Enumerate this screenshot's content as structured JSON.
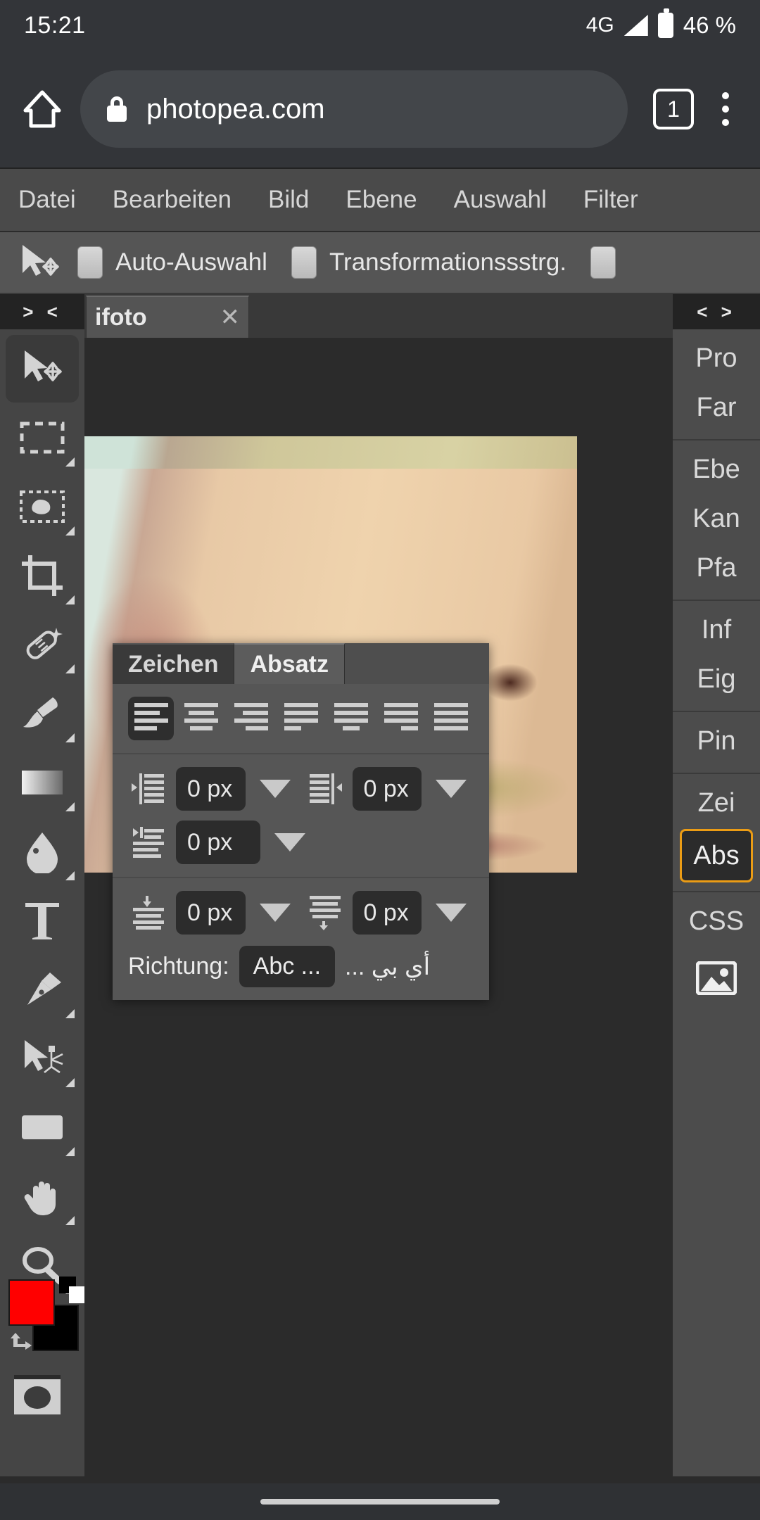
{
  "status_bar": {
    "clock": "15:21",
    "network": "4G",
    "battery_percent": "46 %"
  },
  "browser": {
    "url": "photopea.com",
    "tab_count": "1",
    "home_icon": "home-icon",
    "lock_icon": "lock-icon",
    "menu_icon": "kebab-menu-icon"
  },
  "menu_bar": {
    "items": [
      {
        "label": "Datei"
      },
      {
        "label": "Bearbeiten"
      },
      {
        "label": "Bild"
      },
      {
        "label": "Ebene"
      },
      {
        "label": "Auswahl"
      },
      {
        "label": "Filter"
      }
    ]
  },
  "options_bar": {
    "tool_icon": "move-tool-icon",
    "auto_select_label": "Auto-Auswahl",
    "transform_controls_label": "Transformationssstrg.",
    "auto_select_checked": false,
    "transform_checked": false,
    "third_checked": false
  },
  "left_toolbar": {
    "collapse_label": "> <",
    "tools": [
      {
        "name": "move-tool",
        "active": true
      },
      {
        "name": "rectangular-marquee-tool",
        "active": false
      },
      {
        "name": "lasso-tool",
        "active": false
      },
      {
        "name": "crop-tool",
        "active": false
      },
      {
        "name": "healing-brush-tool",
        "active": false
      },
      {
        "name": "brush-tool",
        "active": false
      },
      {
        "name": "gradient-tool",
        "active": false
      },
      {
        "name": "blur-tool",
        "active": false
      },
      {
        "name": "type-tool",
        "active": false
      },
      {
        "name": "pen-tool",
        "active": false
      },
      {
        "name": "path-select-tool",
        "active": false
      },
      {
        "name": "rectangle-shape-tool",
        "active": false
      },
      {
        "name": "hand-tool",
        "active": false
      },
      {
        "name": "zoom-tool",
        "active": false
      }
    ],
    "foreground_color": "#ff0000",
    "background_color": "#000000",
    "quick_mask_label": "quick-mask-icon"
  },
  "document": {
    "tab_name": "ifoto",
    "close_label": "✕"
  },
  "paragraph_panel": {
    "tabs": [
      {
        "label": "Zeichen",
        "active": false
      },
      {
        "label": "Absatz",
        "active": true
      }
    ],
    "alignment_buttons": [
      {
        "name": "align-left",
        "active": true
      },
      {
        "name": "align-center",
        "active": false
      },
      {
        "name": "align-right",
        "active": false
      },
      {
        "name": "justify-last-left",
        "active": false
      },
      {
        "name": "justify-last-center",
        "active": false
      },
      {
        "name": "justify-last-right",
        "active": false
      },
      {
        "name": "justify-all",
        "active": false
      }
    ],
    "fields": [
      {
        "name": "indent-left",
        "value": "0 px"
      },
      {
        "name": "indent-right",
        "value": "0 px"
      },
      {
        "name": "indent-first-line",
        "value": "0 px"
      },
      {
        "name": "space-before",
        "value": "0 px"
      },
      {
        "name": "space-after",
        "value": "0 px"
      }
    ],
    "direction_label": "Richtung:",
    "direction_ltr": "Abc ...",
    "direction_rtl": "أي بي ..."
  },
  "right_rail": {
    "collapse_label": "< >",
    "groups": [
      {
        "items": [
          {
            "label": "Pro"
          },
          {
            "label": "Far"
          }
        ]
      },
      {
        "items": [
          {
            "label": "Ebe"
          },
          {
            "label": "Kan"
          },
          {
            "label": "Pfa"
          }
        ]
      },
      {
        "items": [
          {
            "label": "Inf"
          },
          {
            "label": "Eig"
          }
        ]
      },
      {
        "items": [
          {
            "label": "Pin"
          }
        ]
      },
      {
        "items": [
          {
            "label": "Zei"
          },
          {
            "label": "Abs",
            "selected": true
          }
        ]
      },
      {
        "items": [
          {
            "label": "CSS"
          },
          {
            "label": "image-icon",
            "icon": true
          }
        ]
      }
    ],
    "selected_accent": "#eb9c15"
  }
}
